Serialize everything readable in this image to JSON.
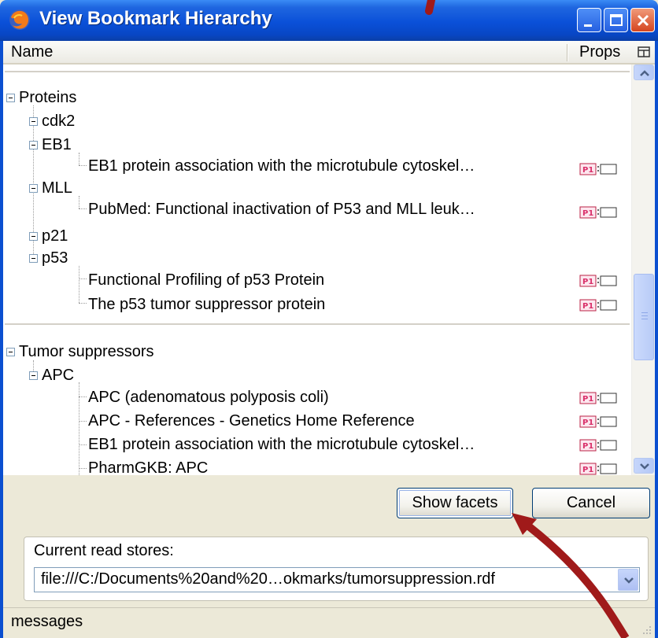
{
  "window": {
    "title": "View Bookmark Hierarchy",
    "app_icon": "firefox-icon"
  },
  "columns": {
    "name": "Name",
    "props": "Props"
  },
  "tree": {
    "groups": [
      {
        "label": "Proteins",
        "children": [
          {
            "label": "cdk2",
            "items": []
          },
          {
            "label": "EB1",
            "items": [
              "EB1 protein association with the microtubule cytoskel…"
            ]
          },
          {
            "label": "MLL",
            "items": [
              "PubMed: Functional inactivation of P53  and MLL leuk…"
            ]
          },
          {
            "label": "p21",
            "items": []
          },
          {
            "label": "p53",
            "items": [
              "Functional Profiling of p53 Protein",
              "The p53 tumor suppressor protein"
            ]
          }
        ]
      },
      {
        "label": "Tumor suppressors",
        "children": [
          {
            "label": "APC",
            "items": [
              "APC (adenomatous polyposis coli)",
              "APC - References - Genetics Home Reference",
              "EB1 protein association with the microtubule cytoskel…",
              "PharmGKB: APC"
            ]
          }
        ]
      }
    ]
  },
  "buttons": {
    "show_facets": "Show facets",
    "cancel": "Cancel"
  },
  "stores": {
    "label": "Current read stores:",
    "value": "file:///C:/Documents%20and%20…okmarks/tumorsuppression.rdf"
  },
  "status": {
    "text": "messages"
  },
  "colors": {
    "titlebar": "#0a50d8",
    "annotation_arrow": "#a01a1a",
    "props_badge": "#d9306a"
  }
}
